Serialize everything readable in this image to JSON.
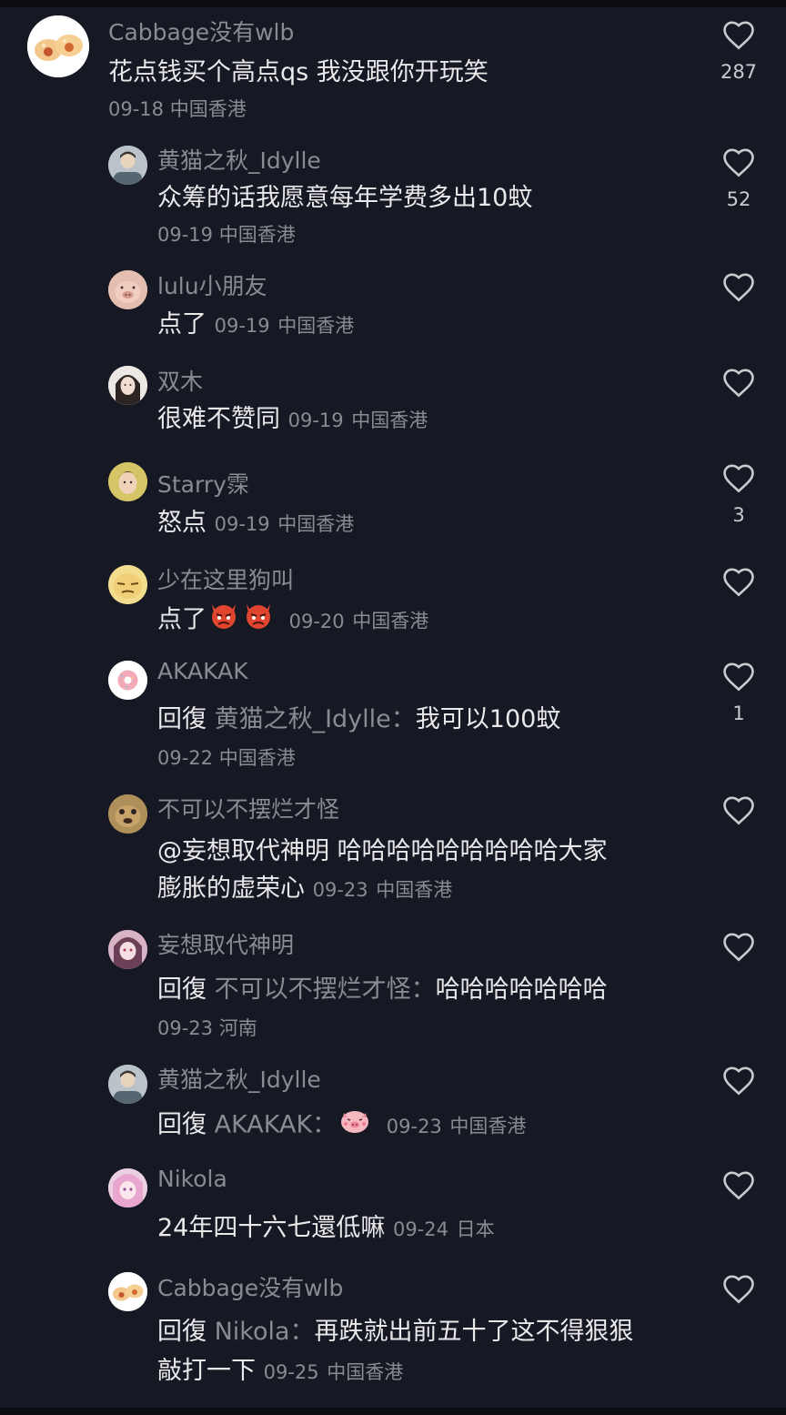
{
  "colors": {
    "background": "#161823",
    "primary_text": "#e9e9ea",
    "secondary_text": "#8a8b91"
  },
  "reply_keyword": "回復",
  "comments": [
    {
      "username": "Cabbage没有wlb",
      "text": "花点钱买个高点qs 我没跟你开玩笑",
      "date": "09-18",
      "location": "中国香港",
      "likes": "287",
      "avatar": "food-buns-avatar"
    },
    {
      "username": "黄猫之秋_Idylle",
      "text": "众筹的话我愿意每年学费多出10蚊",
      "date": "09-19",
      "location": "中国香港",
      "likes": "52",
      "avatar": "person-avatar"
    },
    {
      "username": "lulu小朋友",
      "text": "点了",
      "date": "09-19",
      "location": "中国香港",
      "likes": "",
      "avatar": "pig-avatar"
    },
    {
      "username": "双木",
      "text": "很难不赞同",
      "date": "09-19",
      "location": "中国香港",
      "likes": "",
      "avatar": "girl-avatar"
    },
    {
      "username": "Starry霂",
      "text": "怒点",
      "date": "09-19",
      "location": "中国香港",
      "likes": "3",
      "avatar": "person-avatar"
    },
    {
      "username": "少在这里狗叫",
      "text": "点了",
      "emojis": [
        "angry-devil-emoji",
        "angry-devil-emoji"
      ],
      "date": "09-20",
      "location": "中国香港",
      "likes": "",
      "avatar": "meme-face-avatar"
    },
    {
      "username": "AKAKAK",
      "reply_to": "黄猫之秋_Idylle",
      "text": "我可以100蚊",
      "date": "09-22",
      "location": "中国香港",
      "likes": "1",
      "avatar": "donut-avatar"
    },
    {
      "username": "不可以不摆烂才怪",
      "mention": "@妄想取代神明",
      "text_line1": "哈哈哈哈哈哈哈哈哈大家",
      "text_line2": "膨胀的虚荣心",
      "date": "09-23",
      "location": "中国香港",
      "likes": "",
      "avatar": "dog-avatar"
    },
    {
      "username": "妄想取代神明",
      "reply_to": "不可以不摆烂才怪",
      "text": "哈哈哈哈哈哈哈",
      "date": "09-23",
      "location": "河南",
      "likes": "",
      "avatar": "anime-girl-avatar"
    },
    {
      "username": "黄猫之秋_Idylle",
      "reply_to": "AKAKAK",
      "text": "",
      "emojis": [
        "shy-pig-emoji"
      ],
      "date": "09-23",
      "location": "中国香港",
      "likes": "",
      "avatar": "person-avatar"
    },
    {
      "username": "Nikola",
      "text": "24年四十六七還低嘛",
      "date": "09-24",
      "location": "日本",
      "likes": "",
      "avatar": "anime-pink-avatar"
    },
    {
      "username": "Cabbage没有wlb",
      "reply_to": "Nikola",
      "text_line1": "再跌就出前五十了这不得狠狠",
      "text_line2": "敲打一下",
      "date": "09-25",
      "location": "中国香港",
      "likes": "",
      "avatar": "food-buns-avatar"
    }
  ]
}
